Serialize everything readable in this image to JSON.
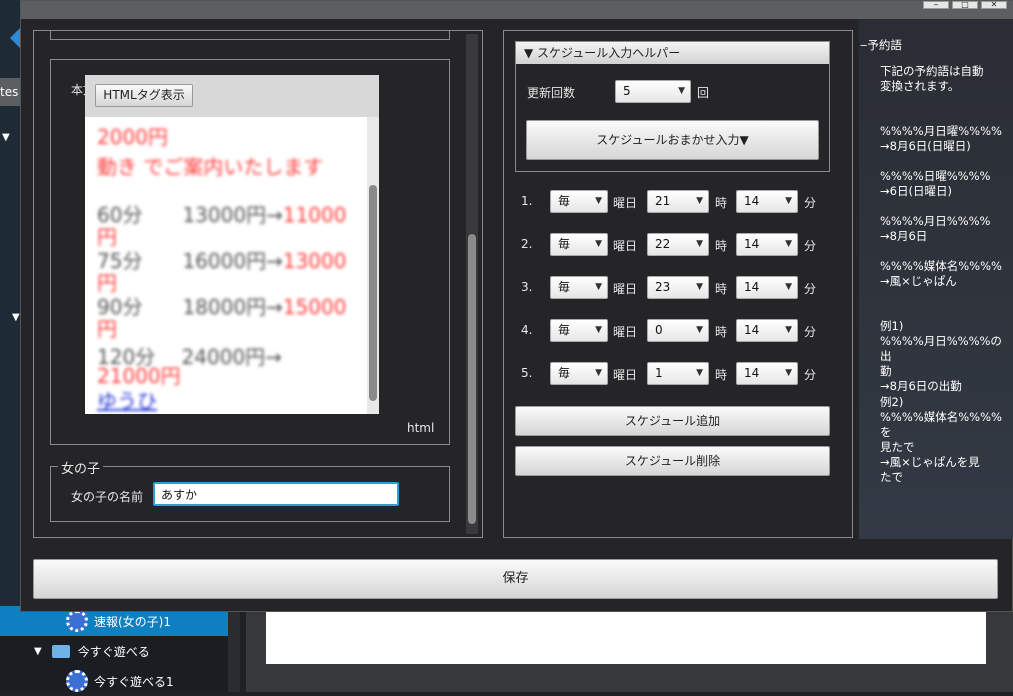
{
  "background": {
    "tab_text": "tes",
    "tree": [
      {
        "label": "速報(女の子)1",
        "type": "gear",
        "selected": true
      },
      {
        "label": "今すぐ遊べる",
        "type": "folder",
        "selected": false
      },
      {
        "label": "今すぐ遊べる1",
        "type": "gear",
        "selected": false
      }
    ]
  },
  "window": {
    "controls": [
      "‒",
      "□",
      "✕"
    ]
  },
  "left": {
    "body_label": "本文",
    "html_tag_button": "HTMLタグ表示",
    "html_label": "html",
    "preview_lines": [
      {
        "text": "2000円",
        "color": "#ff3b3b"
      },
      {
        "text": "動き でご案内いたします",
        "color": "#ff3b3b"
      },
      {
        "text": "60分　　13000円→",
        "accent": "11000",
        "tail": "円"
      },
      {
        "text": "75分　　16000円→",
        "accent": "13000",
        "tail": "円"
      },
      {
        "text": "90分　　18000円→",
        "accent": "15000",
        "tail": "円"
      },
      {
        "text": "120分　 24000円→",
        "accent": "",
        "tail": "21000円"
      }
    ],
    "preview_link": "ゆうひ",
    "girl_group_label": "女の子",
    "girl_name_label": "女の子の名前",
    "girl_name_value": "あすか"
  },
  "schedule": {
    "helper_title": "▼ スケジュール入力ヘルパー",
    "update_count_label": "更新回数",
    "update_count_value": "5",
    "update_count_unit": "回",
    "auto_button": "スケジュールおまかせ入力▼",
    "day_label": "曜日",
    "hour_label": "時",
    "min_label": "分",
    "rows": [
      {
        "num": "1.",
        "day": "毎",
        "hour": "21",
        "min": "14"
      },
      {
        "num": "2.",
        "day": "毎",
        "hour": "22",
        "min": "14"
      },
      {
        "num": "3.",
        "day": "毎",
        "hour": "23",
        "min": "14"
      },
      {
        "num": "4.",
        "day": "毎",
        "hour": "0",
        "min": "14"
      },
      {
        "num": "5.",
        "day": "毎",
        "hour": "1",
        "min": "14"
      }
    ],
    "add_button": "スケジュール追加",
    "delete_button": "スケジュール削除"
  },
  "reserved": {
    "title": "‒予約語",
    "intro": "下記の予約語は自動\n変換されます。",
    "items": [
      "%%%%月日曜%%%%\n→8月6日(日曜日)",
      "%%%%日曜%%%%\n→6日(日曜日)",
      "%%%%月日%%%%\n→8月6日",
      "%%%%媒体名%%%%\n→風×じゃぱん",
      "例1)\n%%%%月日%%%%の出\n勤\n→8月6日の出勤",
      "例2)\n%%%%媒体名%%%%を\n見たで\n→風×じゃぱんを見\nたで"
    ]
  },
  "save_button": "保存"
}
